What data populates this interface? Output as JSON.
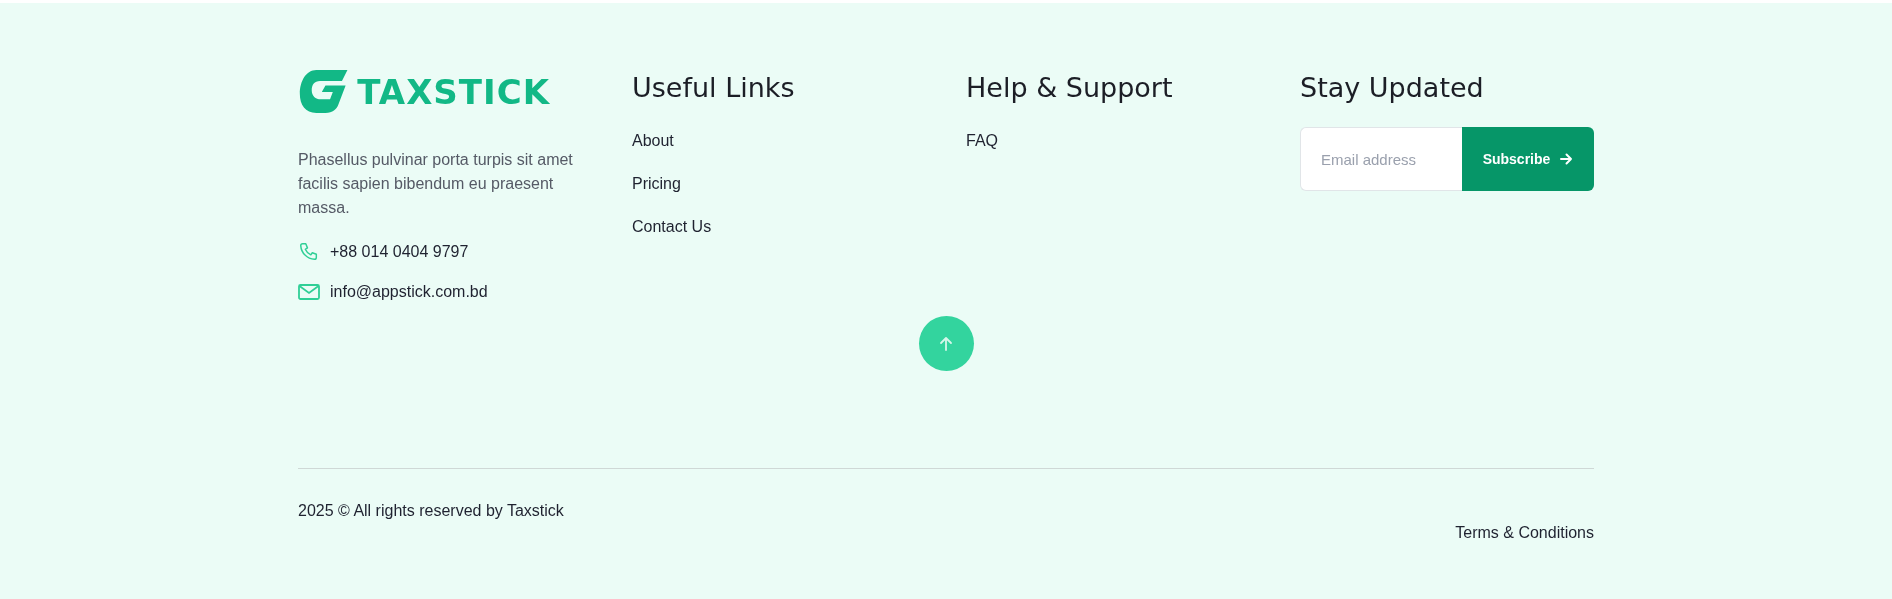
{
  "brand": {
    "logo_text": "TAXSTICK",
    "description": "Phasellus pulvinar porta turpis sit amet facilis sapien bibendum eu praesent massa.",
    "contacts": [
      {
        "kind": "phone",
        "text": "+88 014 0404 9797"
      },
      {
        "kind": "email",
        "text": "info@appstick.com.bd"
      }
    ]
  },
  "useful_links": {
    "title": "Useful Links",
    "items": [
      "About",
      "Pricing",
      "Contact Us"
    ]
  },
  "help_support": {
    "title": "Help & Support",
    "items": [
      "FAQ"
    ]
  },
  "newsletter": {
    "title": "Stay Updated",
    "placeholder": "Email address",
    "button": "Subscribe"
  },
  "copyright": "2025 © All rights reserved by Taxstick",
  "legal_link": "Terms & Conditions"
}
